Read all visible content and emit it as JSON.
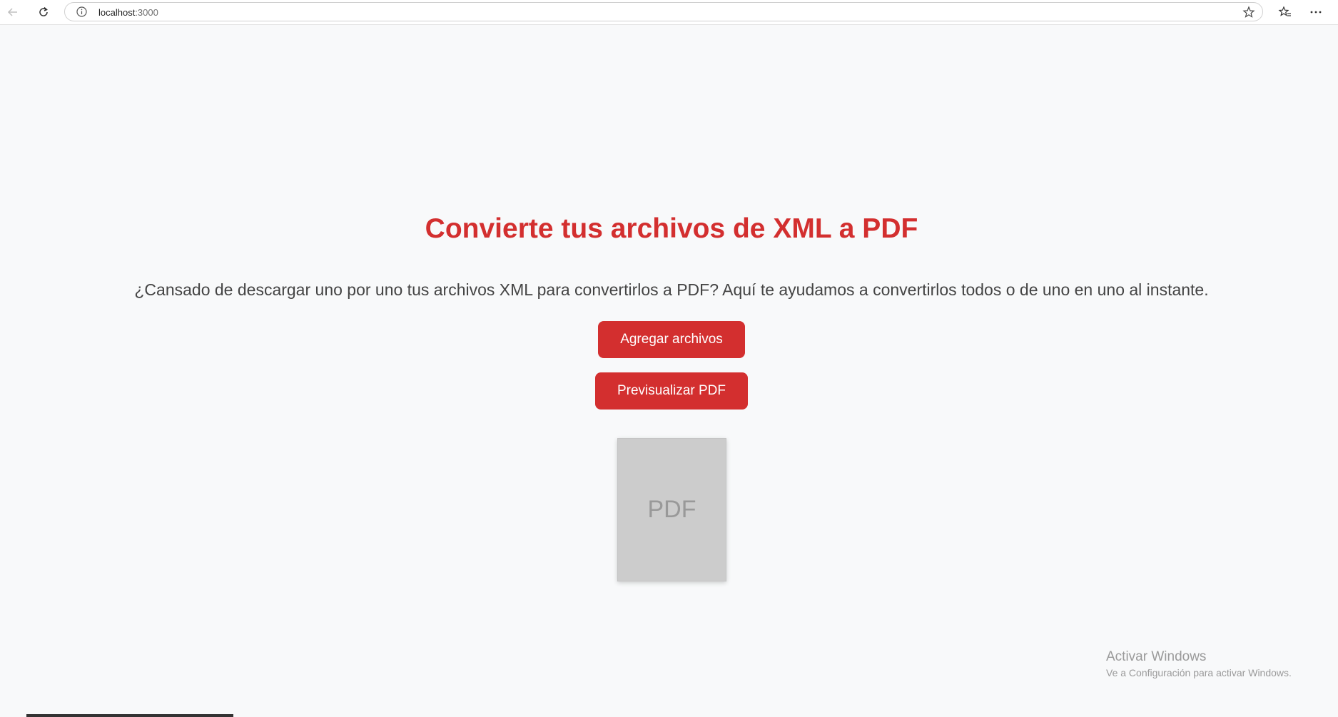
{
  "browser": {
    "url_host": "localhost",
    "url_port": ":3000",
    "icons": [
      "back-arrow-icon",
      "reload-icon",
      "info-icon",
      "star-icon",
      "favorites-icon",
      "more-icon"
    ]
  },
  "main": {
    "title": "Convierte tus archivos de XML a PDF",
    "description": "¿Cansado de descargar uno por uno tus archivos XML para convertirlos a PDF? Aquí te ayudamos a convertirlos todos o de uno en uno al instante.",
    "add_button": "Agregar archivos",
    "preview_button": "Previsualizar PDF",
    "pdf_placeholder": "PDF"
  },
  "watermark": {
    "title": "Activar Windows",
    "subtitle": "Ve a Configuración para activar Windows."
  },
  "colors": {
    "accent": "#d32f2f",
    "background": "#f8f9fa",
    "placeholder": "#cccccc"
  }
}
